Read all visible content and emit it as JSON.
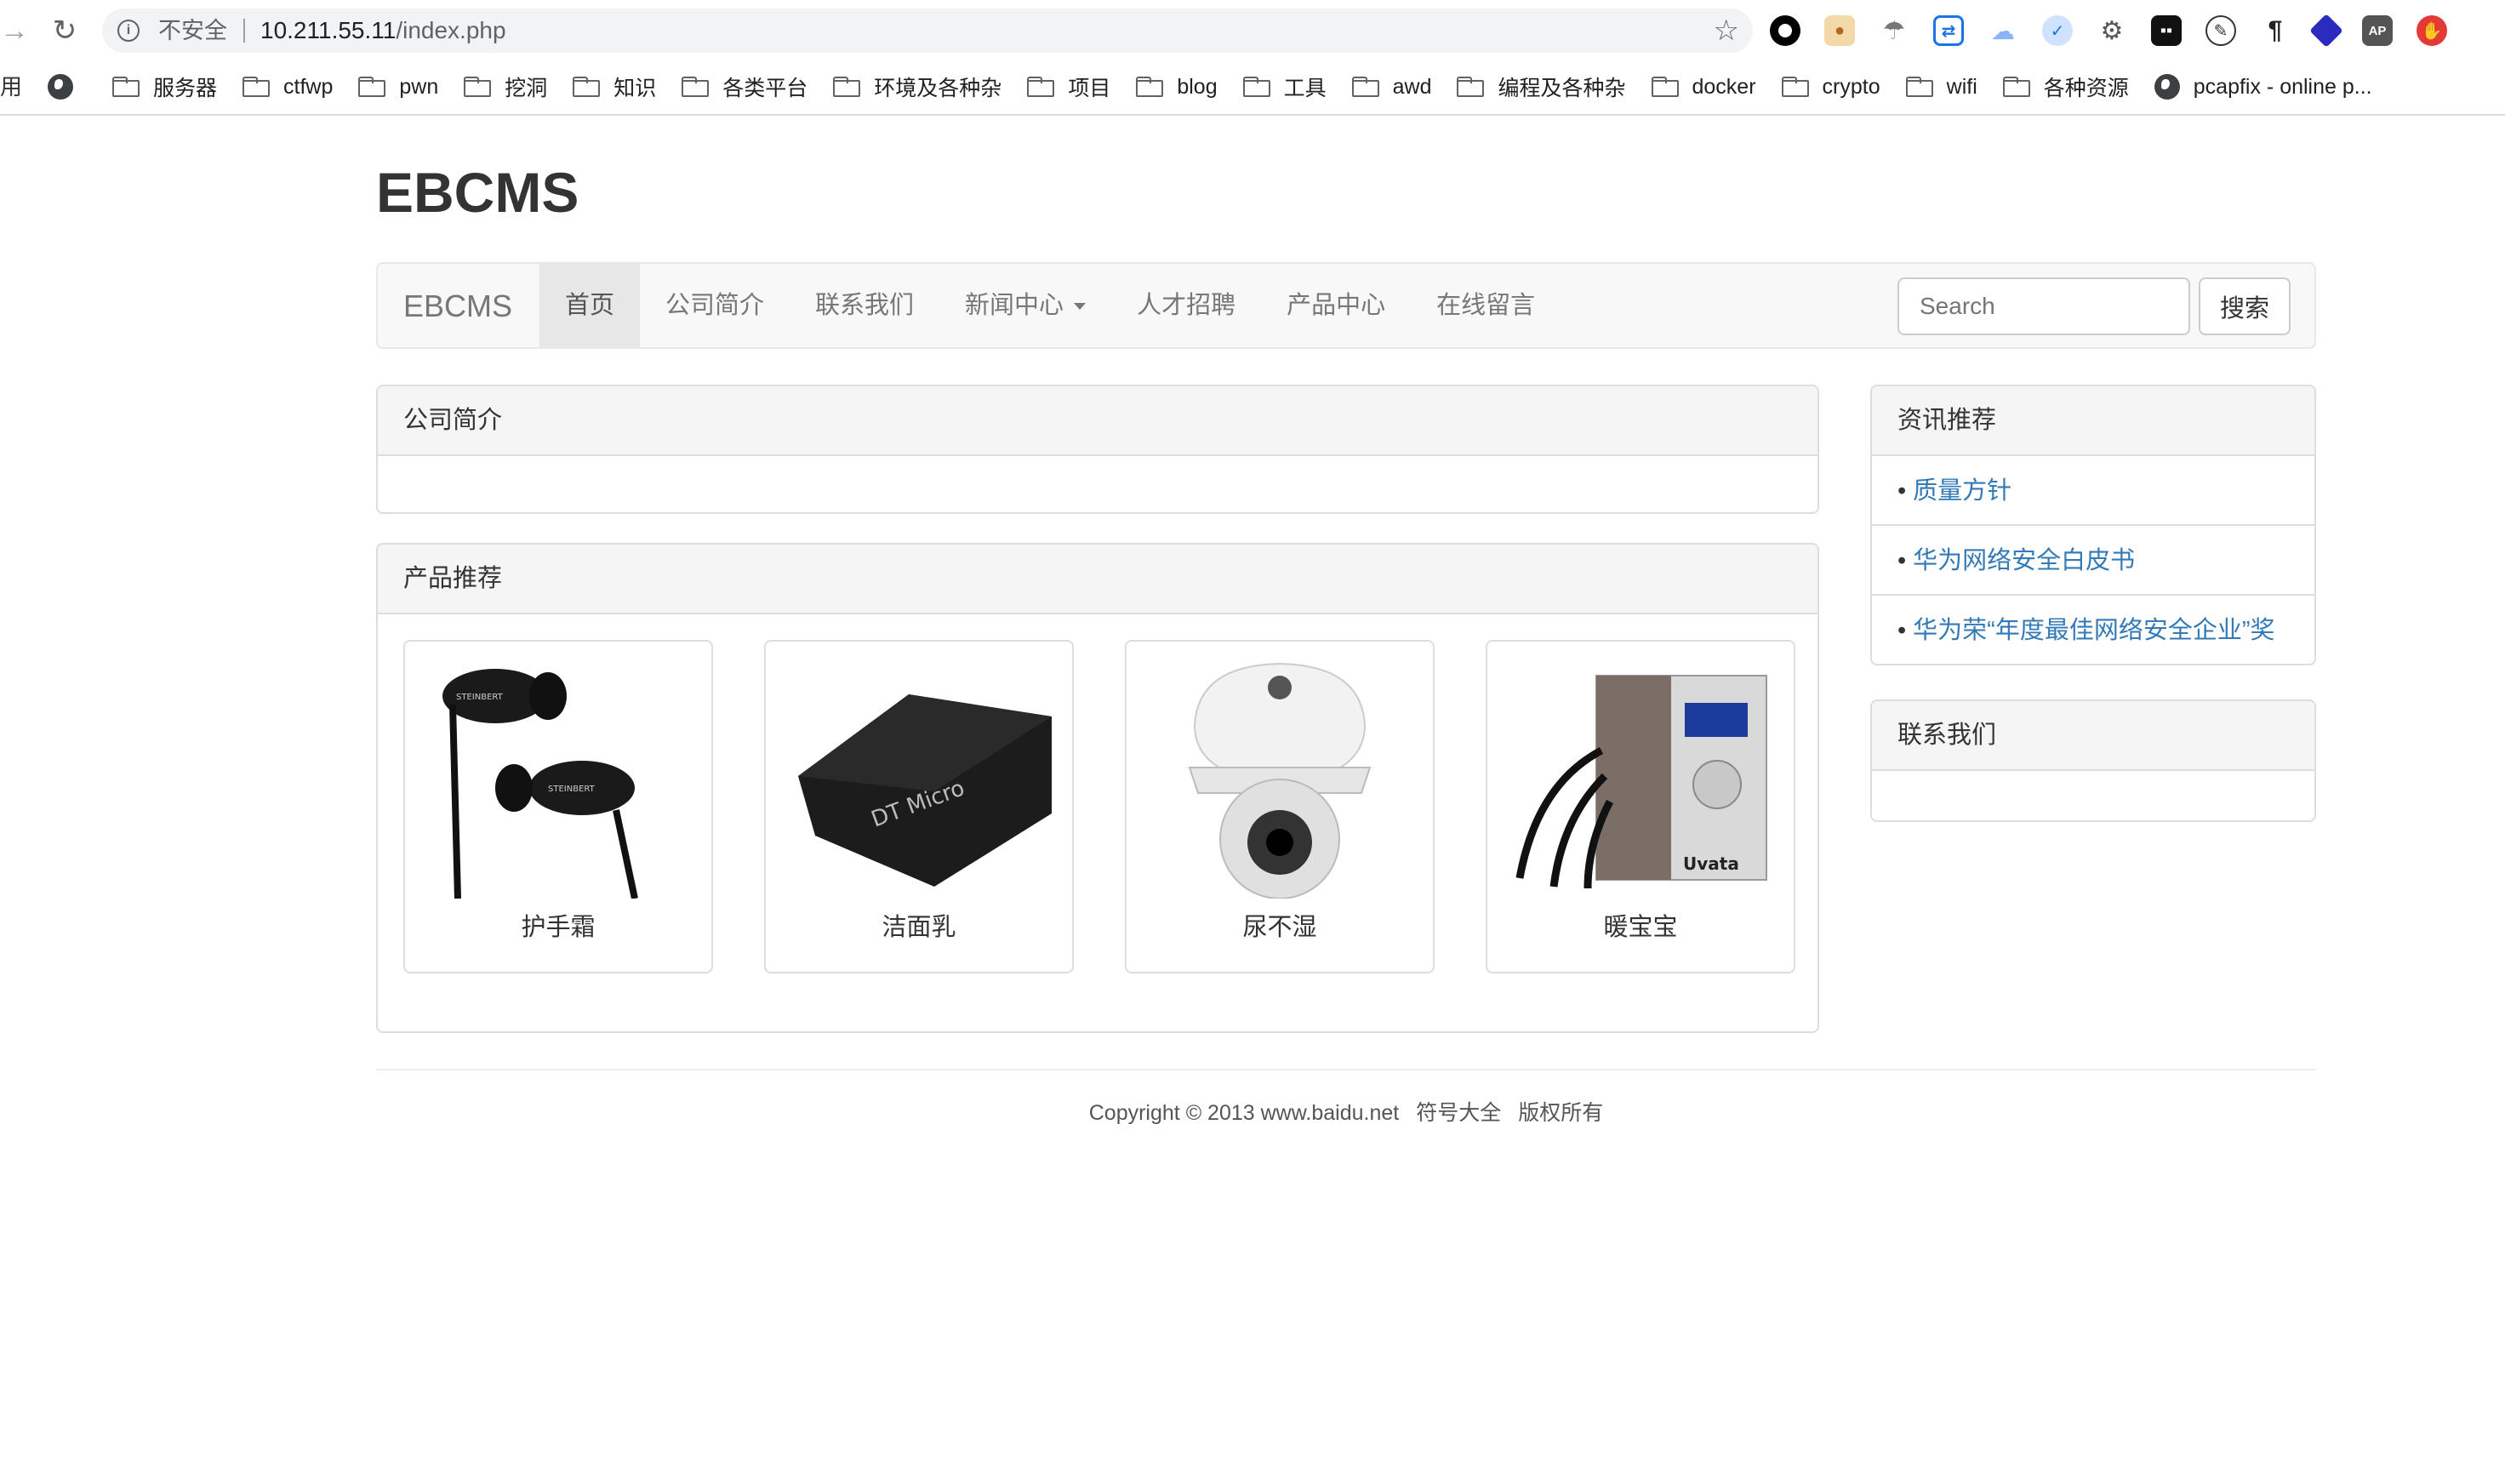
{
  "browser": {
    "security_label": "不安全",
    "url_host": "10.211.55.11",
    "url_path": "/index.php"
  },
  "bookmarks": {
    "cut_label": "用",
    "items": [
      {
        "type": "globe",
        "label": ""
      },
      {
        "type": "folder",
        "label": "服务器"
      },
      {
        "type": "folder",
        "label": "ctfwp"
      },
      {
        "type": "folder",
        "label": "pwn"
      },
      {
        "type": "folder",
        "label": "挖洞"
      },
      {
        "type": "folder",
        "label": "知识"
      },
      {
        "type": "folder",
        "label": "各类平台"
      },
      {
        "type": "folder",
        "label": "环境及各种杂"
      },
      {
        "type": "folder",
        "label": "项目"
      },
      {
        "type": "folder",
        "label": "blog"
      },
      {
        "type": "folder",
        "label": "工具"
      },
      {
        "type": "folder",
        "label": "awd"
      },
      {
        "type": "folder",
        "label": "编程及各种杂"
      },
      {
        "type": "folder",
        "label": "docker"
      },
      {
        "type": "folder",
        "label": "crypto"
      },
      {
        "type": "folder",
        "label": "wifi"
      },
      {
        "type": "folder",
        "label": "各种资源"
      },
      {
        "type": "globe",
        "label": "pcapfix - online p..."
      }
    ]
  },
  "site": {
    "title": "EBCMS",
    "brand": "EBCMS",
    "nav": [
      "首页",
      "公司简介",
      "联系我们",
      "新闻中心",
      "人才招聘",
      "产品中心",
      "在线留言"
    ],
    "active_nav": "首页",
    "search_placeholder": "Search",
    "search_button": "搜索"
  },
  "about_panel": {
    "heading": "公司简介"
  },
  "products_panel": {
    "heading": "产品推荐",
    "products": [
      "护手霜",
      "洁面乳",
      "尿不湿",
      "暖宝宝"
    ],
    "image_labels": [
      "STEINBERT",
      "DT Micro",
      "",
      "Uvata"
    ]
  },
  "news_panel": {
    "heading": "资讯推荐",
    "items": [
      "质量方针",
      "华为网络安全白皮书",
      "华为荣“年度最佳网络安全企业”奖"
    ]
  },
  "contact_panel": {
    "heading": "联系我们"
  },
  "footer": {
    "copyright": "Copyright © 2013 www.baidu.net",
    "link1": "符号大全",
    "link2": "版权所有"
  }
}
